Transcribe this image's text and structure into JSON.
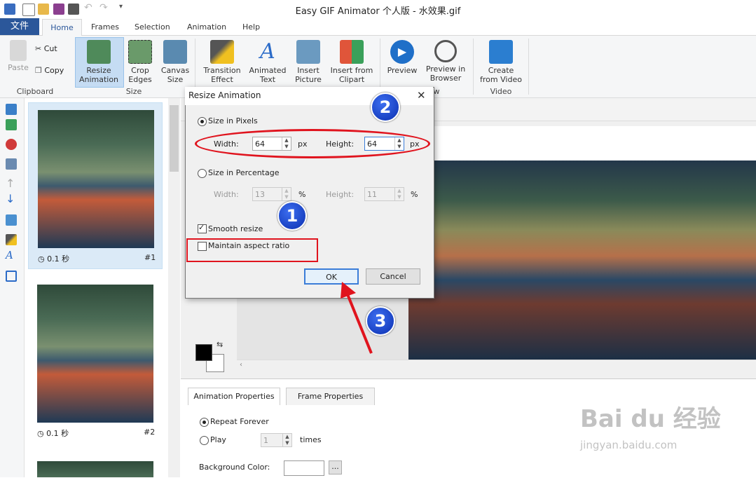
{
  "window": {
    "title": "Easy GIF Animator 个人版 - 水效果.gif"
  },
  "tabs": {
    "file": "文件",
    "home": "Home",
    "frames": "Frames",
    "selection": "Selection",
    "animation": "Animation",
    "help": "Help"
  },
  "ribbon": {
    "paste": "Paste",
    "cut": "Cut",
    "copy": "Copy",
    "clipboard_group": "Clipboard",
    "resize_l1": "Resize",
    "resize_l2": "Animation",
    "crop_l1": "Crop",
    "crop_l2": "Edges",
    "canvas_l1": "Canvas",
    "canvas_l2": "Size",
    "size_group": "Size",
    "transition_l1": "Transition",
    "transition_l2": "Effect",
    "animtext_l1": "Animated",
    "animtext_l2": "Text",
    "insertpic_l1": "Insert",
    "insertpic_l2": "Picture",
    "clipart_l1": "Insert from",
    "clipart_l2": "Clipart",
    "preview": "Preview",
    "browser_l1": "Preview in",
    "browser_l2": "Browser",
    "preview_group_partial": "w",
    "video_l1": "Create",
    "video_l2": "from Video",
    "video_group": "Video"
  },
  "frames": [
    {
      "duration": "0.1 秒",
      "number": "#1"
    },
    {
      "duration": "0.1 秒",
      "number": "#2"
    }
  ],
  "dialog": {
    "title": "Resize Animation",
    "size_pixels": "Size in Pixels",
    "width_label": "Width:",
    "height_label": "Height:",
    "width_value": "64",
    "height_value": "64",
    "px": "px",
    "size_percent": "Size in Percentage",
    "pct_width": "13",
    "pct_height": "11",
    "pct": "%",
    "smooth": "Smooth resize",
    "aspect": "Maintain aspect ratio",
    "ok": "OK",
    "cancel": "Cancel"
  },
  "annotations": {
    "badge1": "1",
    "badge2": "2",
    "badge3": "3"
  },
  "properties": {
    "tab_animation": "Animation Properties",
    "tab_frame": "Frame Properties",
    "repeat": "Repeat Forever",
    "play": "Play",
    "play_times": "1",
    "times": "times",
    "bgcolor": "Background Color:",
    "browse": "..."
  },
  "watermark": {
    "brand": "Bai du 经验",
    "url": "jingyan.baidu.com"
  },
  "colors": {
    "accent": "#2b579a",
    "annotation_red": "#e0141e",
    "badge_blue": "#1a3fd0"
  }
}
